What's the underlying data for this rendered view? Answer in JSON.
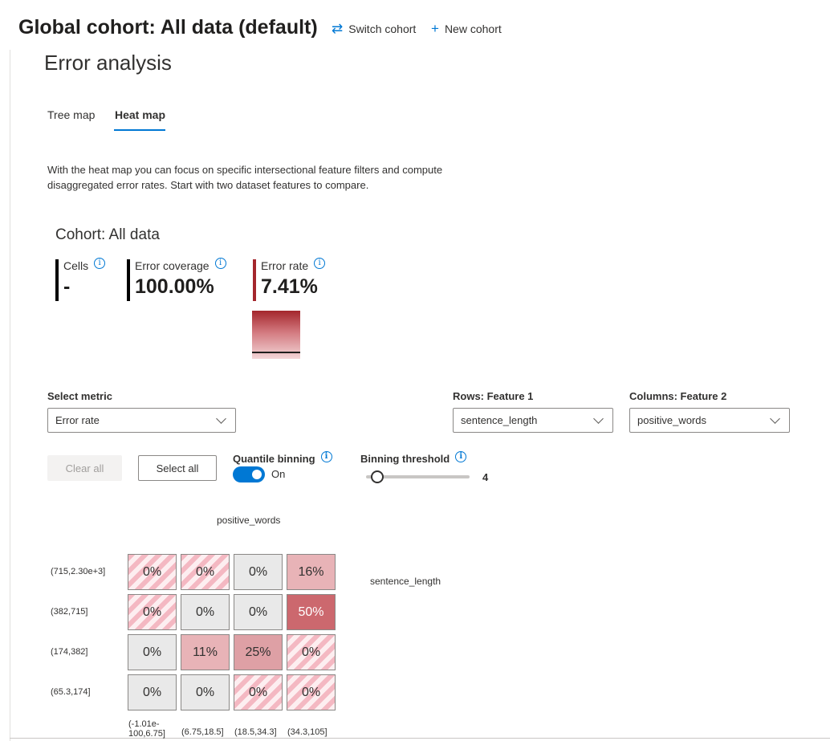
{
  "header": {
    "global_title": "Global cohort: All data (default)",
    "switch_cohort": "Switch cohort",
    "new_cohort": "New cohort",
    "switch_icon": "swap-arrows-icon",
    "new_icon": "plus-icon"
  },
  "page": {
    "title": "Error analysis",
    "tabs": [
      {
        "label": "Tree map",
        "selected": false
      },
      {
        "label": "Heat map",
        "selected": true
      }
    ],
    "description": "With the heat map you can focus on specific intersectional feature filters and compute disaggregated error rates. Start with two dataset features to compare."
  },
  "cohort": {
    "title": "Cohort: All data",
    "metrics": {
      "cells": {
        "label": "Cells",
        "value": "-"
      },
      "coverage": {
        "label": "Error coverage",
        "value": "100.00%"
      },
      "rate": {
        "label": "Error rate",
        "value": "7.41%"
      }
    },
    "accent_color": "#a4262c"
  },
  "controls": {
    "metric_label": "Select metric",
    "metric_value": "Error rate",
    "rows_label": "Rows: Feature 1",
    "rows_value": "sentence_length",
    "cols_label": "Columns: Feature 2",
    "cols_value": "positive_words",
    "clear_all": "Clear all",
    "select_all": "Select all",
    "quantile_label": "Quantile binning",
    "quantile_state": "On",
    "threshold_label": "Binning threshold",
    "threshold_value": "4"
  },
  "heatmap": {
    "column_feature": "positive_words",
    "row_feature": "sentence_length",
    "row_labels": [
      "(715,2.30e+3]",
      "(382,715]",
      "(174,382]",
      "(65.3,174]"
    ],
    "column_labels": [
      "(-1.01e-\n100,6.75]",
      "(6.75,18.5]",
      "(18.5,34.3]",
      "(34.3,105]"
    ],
    "cells": [
      [
        {
          "value": "0%",
          "style": "striped"
        },
        {
          "value": "0%",
          "style": "striped"
        },
        {
          "value": "0%",
          "style": "empty"
        },
        {
          "value": "16%",
          "style": "lt"
        }
      ],
      [
        {
          "value": "0%",
          "style": "striped"
        },
        {
          "value": "0%",
          "style": "empty"
        },
        {
          "value": "0%",
          "style": "empty"
        },
        {
          "value": "50%",
          "style": "dk"
        }
      ],
      [
        {
          "value": "0%",
          "style": "empty"
        },
        {
          "value": "11%",
          "style": "lt"
        },
        {
          "value": "25%",
          "style": "md"
        },
        {
          "value": "0%",
          "style": "striped"
        }
      ],
      [
        {
          "value": "0%",
          "style": "empty"
        },
        {
          "value": "0%",
          "style": "empty"
        },
        {
          "value": "0%",
          "style": "striped"
        },
        {
          "value": "0%",
          "style": "striped"
        }
      ]
    ]
  }
}
